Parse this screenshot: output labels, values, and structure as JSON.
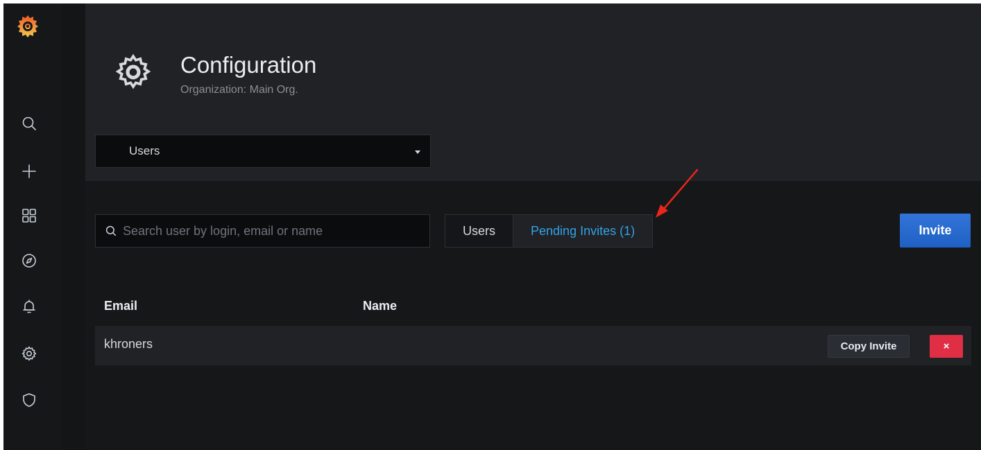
{
  "header": {
    "title": "Configuration",
    "subtitle": "Organization: Main Org."
  },
  "nav_select": {
    "selected": "Users"
  },
  "search": {
    "placeholder": "Search user by login, email or name",
    "value": ""
  },
  "tabs": [
    {
      "label": "Users",
      "active": false
    },
    {
      "label": "Pending Invites (1)",
      "active": true
    }
  ],
  "invite_button": {
    "label": "Invite"
  },
  "table": {
    "columns": [
      "Email",
      "Name"
    ],
    "rows": [
      {
        "email": "khroners",
        "name": ""
      }
    ],
    "copy_label": "Copy Invite",
    "delete_label": "×"
  },
  "sidebar": {
    "items": [
      {
        "icon": "search-icon"
      },
      {
        "icon": "plus-icon"
      },
      {
        "icon": "dashboards-icon"
      },
      {
        "icon": "compass-icon"
      },
      {
        "icon": "bell-icon"
      },
      {
        "icon": "gear-icon"
      },
      {
        "icon": "shield-icon"
      }
    ]
  },
  "colors": {
    "accent_blue": "#33a2e5",
    "primary_button": "#1f60c4",
    "danger": "#e02f44",
    "annotation_arrow": "#e8261c"
  }
}
